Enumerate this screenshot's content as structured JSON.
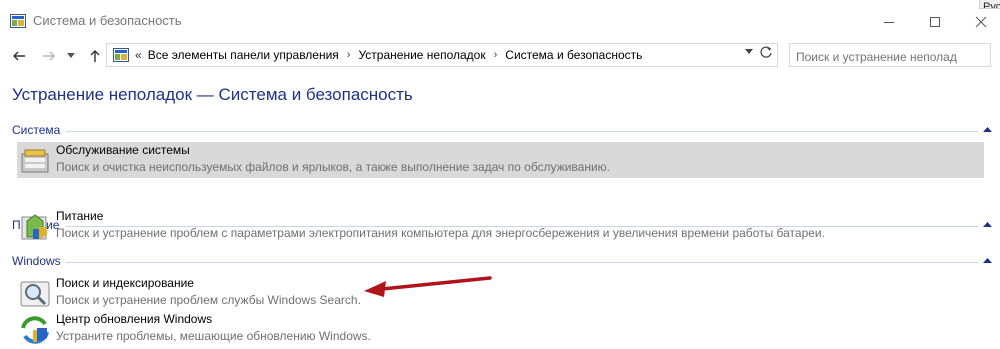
{
  "window": {
    "title": "Система и безопасность",
    "corner_fragment": "Рус"
  },
  "nav": {
    "breadcrumb_prefix": "«",
    "breadcrumbs": [
      "Все элементы панели управления",
      "Устранение неполадок",
      "Система и безопасность"
    ],
    "search_placeholder": "Поиск и устранение неполад"
  },
  "page": {
    "title": "Устранение неполадок — Система и безопасность"
  },
  "sections": [
    {
      "header": "Система",
      "items": [
        {
          "title": "Обслуживание системы",
          "description": "Поиск и очистка неиспользуемых файлов и ярлыков, а также выполнение задач по обслуживанию.",
          "icon": "maintenance-icon"
        }
      ]
    },
    {
      "header": "Питание",
      "items": [
        {
          "title": "Питание",
          "description": "Поиск и устранение проблем с параметрами электропитания компьютера для энергосбережения и увеличения  времени работы батареи.",
          "icon": "power-icon"
        }
      ]
    },
    {
      "header": "Windows",
      "items": [
        {
          "title": "Поиск и индексирование",
          "description": "Поиск и устранение проблем службы Windows Search.",
          "icon": "search-indexing-icon"
        },
        {
          "title": "Центр обновления Windows",
          "description": "Устраните проблемы, мешающие обновлению Windows.",
          "icon": "windows-update-icon"
        }
      ]
    }
  ],
  "colors": {
    "heading_blue": "#1e3287",
    "section_line": "#c6d7e9",
    "selected_bg": "#d9d9d9",
    "annotation_arrow": "#b0141a"
  }
}
